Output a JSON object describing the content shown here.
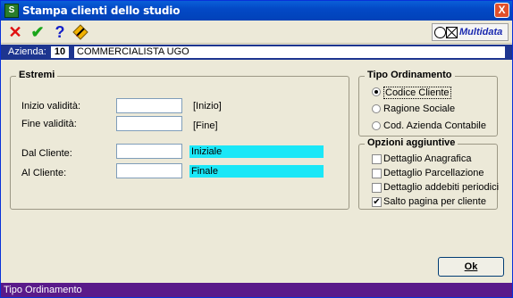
{
  "window": {
    "title": "Stampa clienti dello studio",
    "close_glyph": "X",
    "icon": "app-icon"
  },
  "toolbar": {
    "buttons": [
      {
        "icon": "cancel-x-icon",
        "color": "#e01010"
      },
      {
        "icon": "confirm-check-icon",
        "color": "#1aa51a"
      },
      {
        "icon": "help-question-icon",
        "color": "#1420c8"
      },
      {
        "icon": "edit-pen-icon",
        "color": "#e0a000"
      }
    ],
    "brand": "Multidata"
  },
  "azienda": {
    "label": "Azienda:",
    "code": "10",
    "name": "COMMERCIALISTA UGO"
  },
  "estremi": {
    "title": "Estremi",
    "inizio_label": "Inizio validità:",
    "inizio_value": "",
    "inizio_note": "[Inizio]",
    "fine_label": "Fine validità:",
    "fine_value": "",
    "fine_note": "[Fine]",
    "dal_label": "Dal Cliente:",
    "dal_value": "",
    "dal_note": "Iniziale",
    "al_label": "Al Cliente:",
    "al_value": "",
    "al_note": "Finale"
  },
  "tipo_ordinamento": {
    "title": "Tipo Ordinamento",
    "options": [
      "Codice Cliente",
      "Ragione Sociale",
      "Cod. Azienda Contabile"
    ],
    "selected": "Codice Cliente"
  },
  "opzioni": {
    "title": "Opzioni aggiuntive",
    "items": [
      {
        "label": "Dettaglio Anagrafica",
        "checked": false
      },
      {
        "label": "Dettaglio Parcellazione",
        "checked": false
      },
      {
        "label": "Dettaglio addebiti periodici",
        "checked": false
      },
      {
        "label": "Salto pagina per cliente",
        "checked": true
      }
    ]
  },
  "ok_button": "Ok",
  "status": "Tipo Ordinamento",
  "colors": {
    "titlebar": "#0349c6",
    "azbar": "#1d3590",
    "highlight": "#1ae7f7",
    "statusbar": "#5a1a8a"
  }
}
